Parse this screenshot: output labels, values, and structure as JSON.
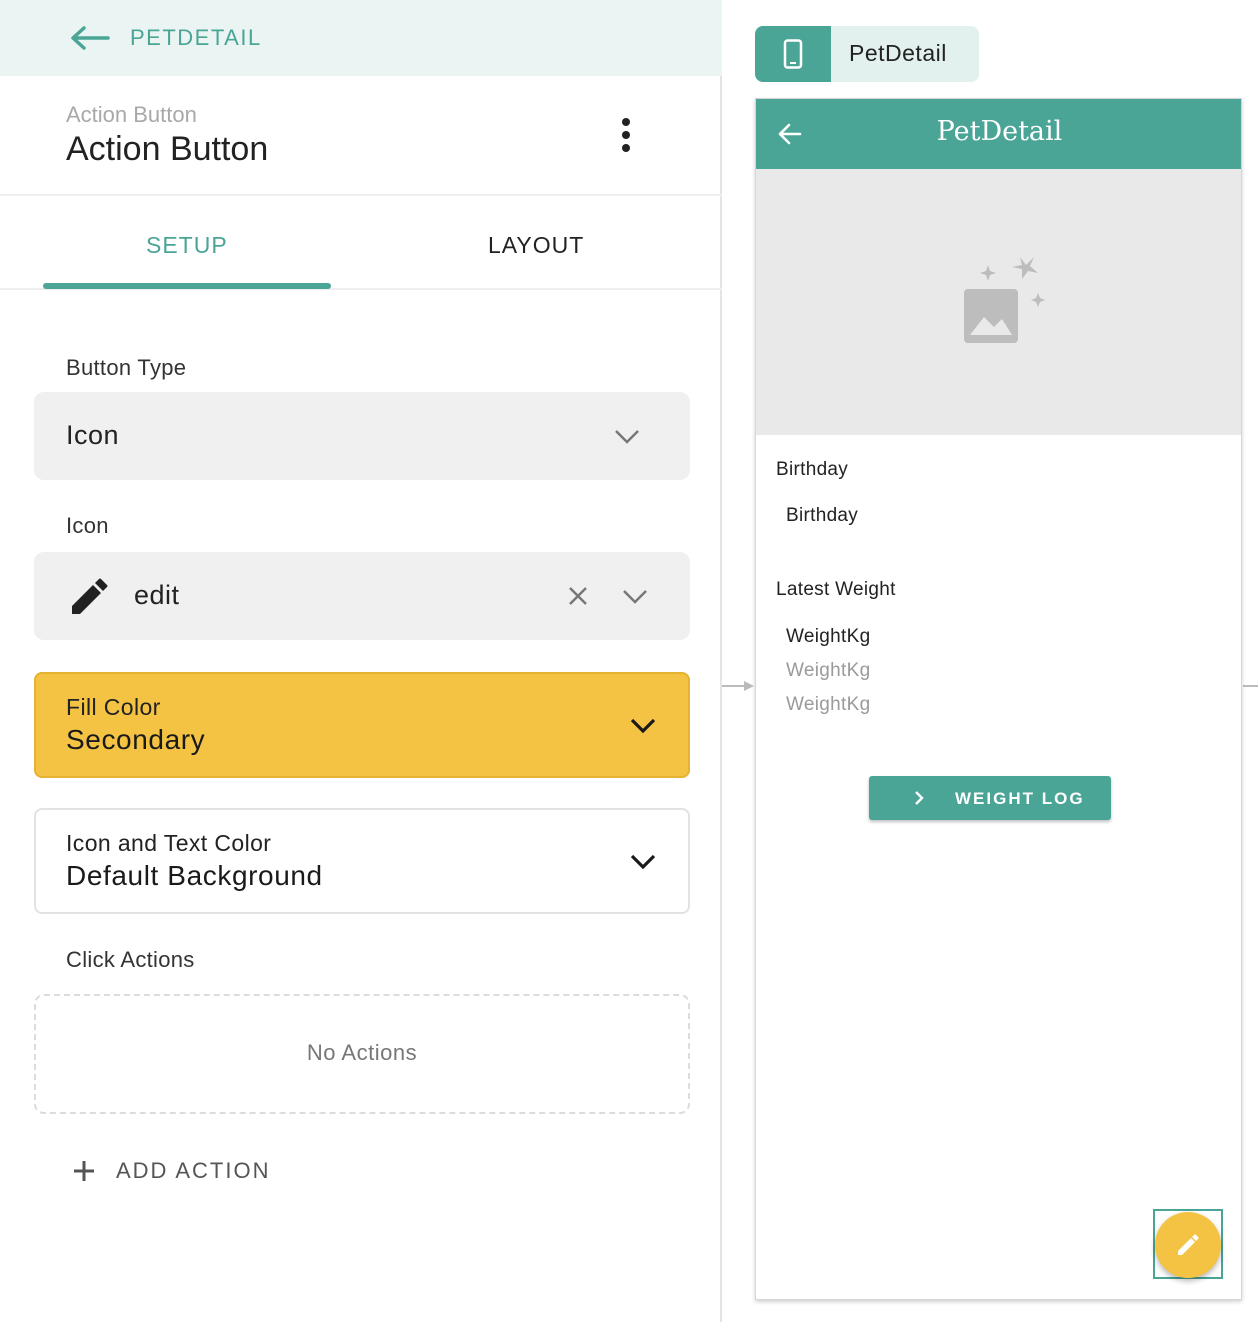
{
  "topbar": {
    "crumb": "PETDETAIL",
    "back_icon": "arrow-left-icon"
  },
  "component": {
    "subtitle": "Action Button",
    "title": "Action Button",
    "menu_icon": "more-vertical-icon"
  },
  "tabs": [
    {
      "label": "SETUP",
      "active": true
    },
    {
      "label": "LAYOUT",
      "active": false
    }
  ],
  "button_type": {
    "label": "Button Type",
    "value": "Icon"
  },
  "icon_field": {
    "label": "Icon",
    "value": "edit",
    "icon": "pencil-icon",
    "clear_icon": "close-icon"
  },
  "fill_color": {
    "label": "Fill Color",
    "value": "Secondary",
    "color": "#f4c343"
  },
  "text_color": {
    "label": "Icon and Text Color",
    "value": "Default Background"
  },
  "click_actions": {
    "label": "Click Actions",
    "empty_text": "No Actions",
    "add_label": "ADD ACTION"
  },
  "preview": {
    "screen_name": "PetDetail",
    "screen_icon": "phone-icon",
    "app_title": "PetDetail",
    "hero_icon": "image-placeholder-icon",
    "fields": [
      {
        "label": "Birthday",
        "values": [
          "Birthday"
        ]
      },
      {
        "label": "Latest Weight",
        "values": [
          "WeightKg",
          "WeightKg",
          "WeightKg"
        ]
      }
    ],
    "weight_button": "WEIGHT LOG",
    "fab_icon": "pencil-icon"
  },
  "colors": {
    "accent": "#4aa597",
    "secondary": "#f4c343",
    "topbar_bg": "#eaf4f2"
  }
}
